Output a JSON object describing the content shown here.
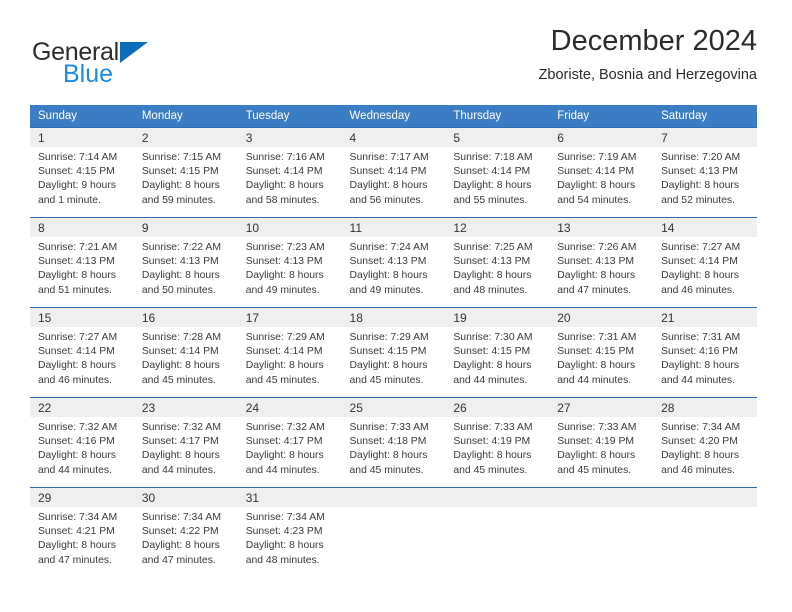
{
  "brand": {
    "name_part1": "General",
    "name_part2": "Blue",
    "triangle_color": "#0a6ebd",
    "blue_color": "#1a8ae5"
  },
  "header": {
    "title": "December 2024",
    "subtitle": "Zboriste, Bosnia and Herzegovina"
  },
  "theme": {
    "header_bg": "#3b7dc4",
    "row_border": "#2e6bb0",
    "daynum_band": "#efefef"
  },
  "weekdays": [
    "Sunday",
    "Monday",
    "Tuesday",
    "Wednesday",
    "Thursday",
    "Friday",
    "Saturday"
  ],
  "weeks": [
    [
      {
        "day": "1",
        "lines": [
          "Sunrise: 7:14 AM",
          "Sunset: 4:15 PM",
          "Daylight: 9 hours",
          "and 1 minute."
        ]
      },
      {
        "day": "2",
        "lines": [
          "Sunrise: 7:15 AM",
          "Sunset: 4:15 PM",
          "Daylight: 8 hours",
          "and 59 minutes."
        ]
      },
      {
        "day": "3",
        "lines": [
          "Sunrise: 7:16 AM",
          "Sunset: 4:14 PM",
          "Daylight: 8 hours",
          "and 58 minutes."
        ]
      },
      {
        "day": "4",
        "lines": [
          "Sunrise: 7:17 AM",
          "Sunset: 4:14 PM",
          "Daylight: 8 hours",
          "and 56 minutes."
        ]
      },
      {
        "day": "5",
        "lines": [
          "Sunrise: 7:18 AM",
          "Sunset: 4:14 PM",
          "Daylight: 8 hours",
          "and 55 minutes."
        ]
      },
      {
        "day": "6",
        "lines": [
          "Sunrise: 7:19 AM",
          "Sunset: 4:14 PM",
          "Daylight: 8 hours",
          "and 54 minutes."
        ]
      },
      {
        "day": "7",
        "lines": [
          "Sunrise: 7:20 AM",
          "Sunset: 4:13 PM",
          "Daylight: 8 hours",
          "and 52 minutes."
        ]
      }
    ],
    [
      {
        "day": "8",
        "lines": [
          "Sunrise: 7:21 AM",
          "Sunset: 4:13 PM",
          "Daylight: 8 hours",
          "and 51 minutes."
        ]
      },
      {
        "day": "9",
        "lines": [
          "Sunrise: 7:22 AM",
          "Sunset: 4:13 PM",
          "Daylight: 8 hours",
          "and 50 minutes."
        ]
      },
      {
        "day": "10",
        "lines": [
          "Sunrise: 7:23 AM",
          "Sunset: 4:13 PM",
          "Daylight: 8 hours",
          "and 49 minutes."
        ]
      },
      {
        "day": "11",
        "lines": [
          "Sunrise: 7:24 AM",
          "Sunset: 4:13 PM",
          "Daylight: 8 hours",
          "and 49 minutes."
        ]
      },
      {
        "day": "12",
        "lines": [
          "Sunrise: 7:25 AM",
          "Sunset: 4:13 PM",
          "Daylight: 8 hours",
          "and 48 minutes."
        ]
      },
      {
        "day": "13",
        "lines": [
          "Sunrise: 7:26 AM",
          "Sunset: 4:13 PM",
          "Daylight: 8 hours",
          "and 47 minutes."
        ]
      },
      {
        "day": "14",
        "lines": [
          "Sunrise: 7:27 AM",
          "Sunset: 4:14 PM",
          "Daylight: 8 hours",
          "and 46 minutes."
        ]
      }
    ],
    [
      {
        "day": "15",
        "lines": [
          "Sunrise: 7:27 AM",
          "Sunset: 4:14 PM",
          "Daylight: 8 hours",
          "and 46 minutes."
        ]
      },
      {
        "day": "16",
        "lines": [
          "Sunrise: 7:28 AM",
          "Sunset: 4:14 PM",
          "Daylight: 8 hours",
          "and 45 minutes."
        ]
      },
      {
        "day": "17",
        "lines": [
          "Sunrise: 7:29 AM",
          "Sunset: 4:14 PM",
          "Daylight: 8 hours",
          "and 45 minutes."
        ]
      },
      {
        "day": "18",
        "lines": [
          "Sunrise: 7:29 AM",
          "Sunset: 4:15 PM",
          "Daylight: 8 hours",
          "and 45 minutes."
        ]
      },
      {
        "day": "19",
        "lines": [
          "Sunrise: 7:30 AM",
          "Sunset: 4:15 PM",
          "Daylight: 8 hours",
          "and 44 minutes."
        ]
      },
      {
        "day": "20",
        "lines": [
          "Sunrise: 7:31 AM",
          "Sunset: 4:15 PM",
          "Daylight: 8 hours",
          "and 44 minutes."
        ]
      },
      {
        "day": "21",
        "lines": [
          "Sunrise: 7:31 AM",
          "Sunset: 4:16 PM",
          "Daylight: 8 hours",
          "and 44 minutes."
        ]
      }
    ],
    [
      {
        "day": "22",
        "lines": [
          "Sunrise: 7:32 AM",
          "Sunset: 4:16 PM",
          "Daylight: 8 hours",
          "and 44 minutes."
        ]
      },
      {
        "day": "23",
        "lines": [
          "Sunrise: 7:32 AM",
          "Sunset: 4:17 PM",
          "Daylight: 8 hours",
          "and 44 minutes."
        ]
      },
      {
        "day": "24",
        "lines": [
          "Sunrise: 7:32 AM",
          "Sunset: 4:17 PM",
          "Daylight: 8 hours",
          "and 44 minutes."
        ]
      },
      {
        "day": "25",
        "lines": [
          "Sunrise: 7:33 AM",
          "Sunset: 4:18 PM",
          "Daylight: 8 hours",
          "and 45 minutes."
        ]
      },
      {
        "day": "26",
        "lines": [
          "Sunrise: 7:33 AM",
          "Sunset: 4:19 PM",
          "Daylight: 8 hours",
          "and 45 minutes."
        ]
      },
      {
        "day": "27",
        "lines": [
          "Sunrise: 7:33 AM",
          "Sunset: 4:19 PM",
          "Daylight: 8 hours",
          "and 45 minutes."
        ]
      },
      {
        "day": "28",
        "lines": [
          "Sunrise: 7:34 AM",
          "Sunset: 4:20 PM",
          "Daylight: 8 hours",
          "and 46 minutes."
        ]
      }
    ],
    [
      {
        "day": "29",
        "lines": [
          "Sunrise: 7:34 AM",
          "Sunset: 4:21 PM",
          "Daylight: 8 hours",
          "and 47 minutes."
        ]
      },
      {
        "day": "30",
        "lines": [
          "Sunrise: 7:34 AM",
          "Sunset: 4:22 PM",
          "Daylight: 8 hours",
          "and 47 minutes."
        ]
      },
      {
        "day": "31",
        "lines": [
          "Sunrise: 7:34 AM",
          "Sunset: 4:23 PM",
          "Daylight: 8 hours",
          "and 48 minutes."
        ]
      },
      {
        "day": "",
        "lines": []
      },
      {
        "day": "",
        "lines": []
      },
      {
        "day": "",
        "lines": []
      },
      {
        "day": "",
        "lines": []
      }
    ]
  ]
}
